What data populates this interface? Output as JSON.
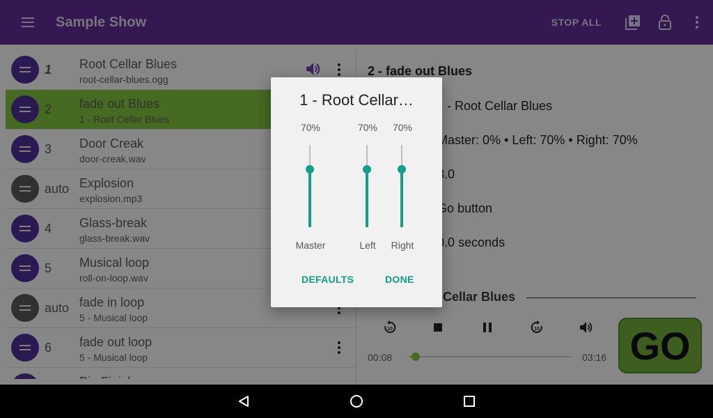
{
  "appbar": {
    "title": "Sample Show",
    "stop_all_label": "STOP ALL"
  },
  "cues": [
    {
      "number": "1",
      "name": "Root Cellar Blues",
      "file": "root-cellar-blues.ogg",
      "drag_color": "purple",
      "playing": true,
      "number_italic": true
    },
    {
      "number": "2",
      "name": "fade out Blues",
      "file": "1 - Root Cellar Blues",
      "drag_color": "purple",
      "selected": true
    },
    {
      "number": "3",
      "name": "Door Creak",
      "file": "door-creak.wav",
      "drag_color": "purple"
    },
    {
      "number": "auto",
      "name": "Explosion",
      "file": "explosion.mp3",
      "drag_color": "gray"
    },
    {
      "number": "4",
      "name": "Glass-break",
      "file": "glass-break.wav",
      "drag_color": "purple"
    },
    {
      "number": "5",
      "name": "Musical loop",
      "file": "roll-on-loop.wav",
      "drag_color": "purple"
    },
    {
      "number": "auto",
      "name": "fade in loop",
      "file": "5 - Musical loop",
      "drag_color": "gray"
    },
    {
      "number": "6",
      "name": "fade out loop",
      "file": "5 - Musical loop",
      "drag_color": "purple"
    },
    {
      "number": "",
      "name": "Big Finish",
      "file": "",
      "drag_color": "purple"
    }
  ],
  "detail": {
    "heading": "2 - fade out Blues",
    "lines": [
      "- Root Cellar Blues",
      "Master: 0% • Left: 70% • Right: 70%",
      "3.0",
      "Go button",
      "0.0 seconds"
    ]
  },
  "now_playing": {
    "title": "ot Cellar Blues",
    "elapsed": "00:08",
    "total": "03:16",
    "progress": 0.04
  },
  "go_label": "GO",
  "dialog": {
    "title": "1 - Root Cellar…",
    "sliders": [
      {
        "label": "Master",
        "percent_text": "70%",
        "value": 0.7
      },
      {
        "label": "Left",
        "percent_text": "70%",
        "value": 0.7
      },
      {
        "label": "Right",
        "percent_text": "70%",
        "value": 0.7
      }
    ],
    "defaults_label": "DEFAULTS",
    "done_label": "DONE"
  },
  "colors": {
    "appbar": "#5b2a8c",
    "selected_row": "#79b73a",
    "accent_teal": "#119f8c",
    "go_green": "#6ca336"
  }
}
